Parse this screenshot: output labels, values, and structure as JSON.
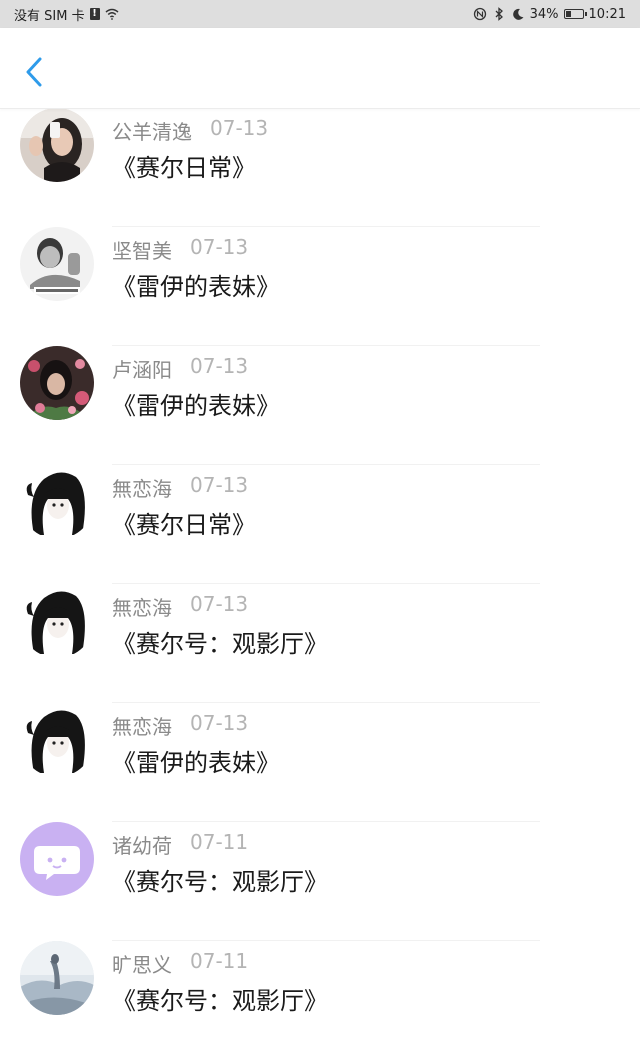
{
  "status_bar": {
    "carrier": "没有 SIM 卡",
    "sim_alert": "!",
    "battery": "34%",
    "time": "10:21",
    "battery_level": 0.34
  },
  "header": {
    "back_icon": "chevron-left-icon",
    "accent_color": "#2e9bea"
  },
  "items": [
    {
      "name": "公羊清逸",
      "date": "07-13",
      "title": "《赛尔日常》",
      "avatar": "photo-girl"
    },
    {
      "name": "坚智美",
      "date": "07-13",
      "title": "《雷伊的表妹》",
      "avatar": "photo-boy-bw"
    },
    {
      "name": "卢涵阳",
      "date": "07-13",
      "title": "《雷伊的表妹》",
      "avatar": "photo-flowers"
    },
    {
      "name": "無恋海",
      "date": "07-13",
      "title": "《赛尔日常》",
      "avatar": "anime-girl"
    },
    {
      "name": "無恋海",
      "date": "07-13",
      "title": "《赛尔号：观影厅》",
      "avatar": "anime-girl"
    },
    {
      "name": "無恋海",
      "date": "07-13",
      "title": "《雷伊的表妹》",
      "avatar": "anime-girl"
    },
    {
      "name": "诸幼荷",
      "date": "07-11",
      "title": "《赛尔号：观影厅》",
      "avatar": "chat-bubble"
    },
    {
      "name": "旷思义",
      "date": "07-11",
      "title": "《赛尔号：观影厅》",
      "avatar": "photo-landscape"
    }
  ]
}
